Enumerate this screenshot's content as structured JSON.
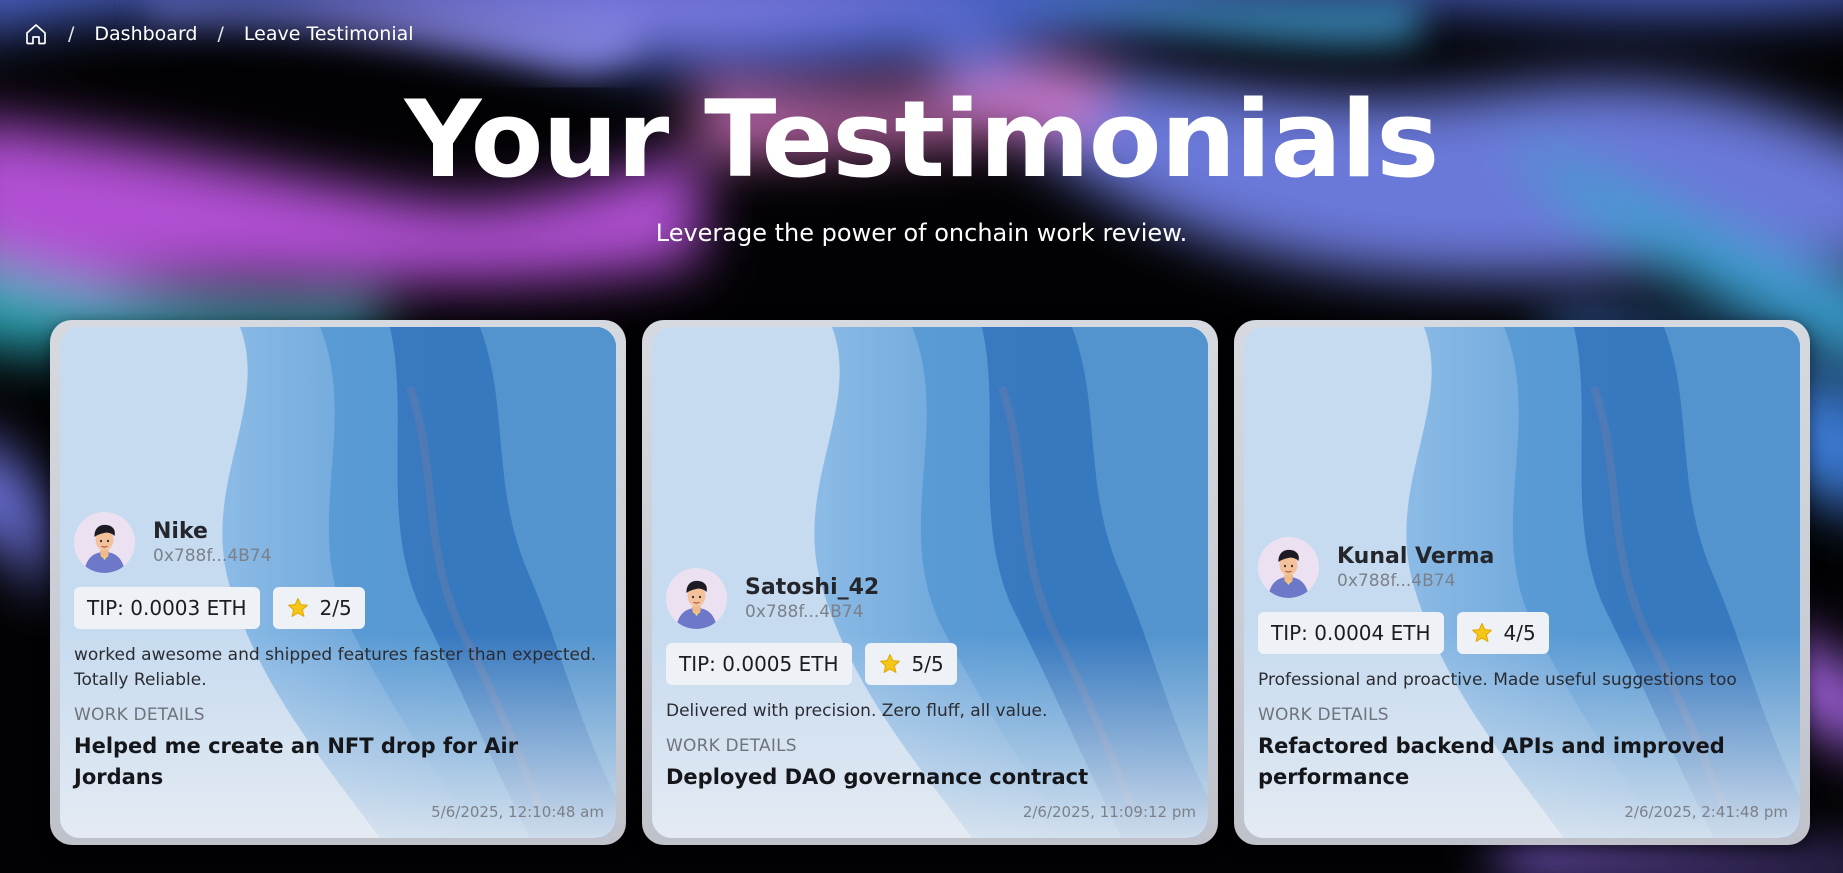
{
  "breadcrumb": {
    "home_icon": "home-icon",
    "items": [
      "Dashboard",
      "Leave Testimonial"
    ],
    "separator": "/"
  },
  "header": {
    "title": "Your Testimonials",
    "subtitle": "Leverage the power of onchain work review."
  },
  "testimonials": [
    {
      "name": "Nike",
      "address": "0x788f...4B74",
      "tip": "TIP: 0.0003 ETH",
      "rating": "2/5",
      "review": "worked awesome and shipped features faster than expected. Totally Reliable.",
      "work_label": "WORK DETAILS",
      "work": "Helped me create an NFT drop for Air Jordans",
      "timestamp": "5/6/2025, 12:10:48 am"
    },
    {
      "name": "Satoshi_42",
      "address": "0x788f...4B74",
      "tip": "TIP: 0.0005 ETH",
      "rating": "5/5",
      "review": "Delivered with precision. Zero fluff, all value.",
      "work_label": "WORK DETAILS",
      "work": "Deployed DAO governance contract",
      "timestamp": "2/6/2025, 11:09:12 pm"
    },
    {
      "name": "Kunal Verma",
      "address": "0x788f...4B74",
      "tip": "TIP: 0.0004 ETH",
      "rating": "4/5",
      "review": "Professional and proactive. Made useful suggestions too",
      "work_label": "WORK DETAILS",
      "work": "Refactored backend APIs and improved performance",
      "timestamp": "2/6/2025, 2:41:48 pm"
    }
  ],
  "colors": {
    "accent_purple": "#9b7fe6",
    "accent_pink": "#c55ce0",
    "accent_teal": "#2fa6b8",
    "card_blue": "#4f92cf",
    "star": "#f5c518"
  }
}
